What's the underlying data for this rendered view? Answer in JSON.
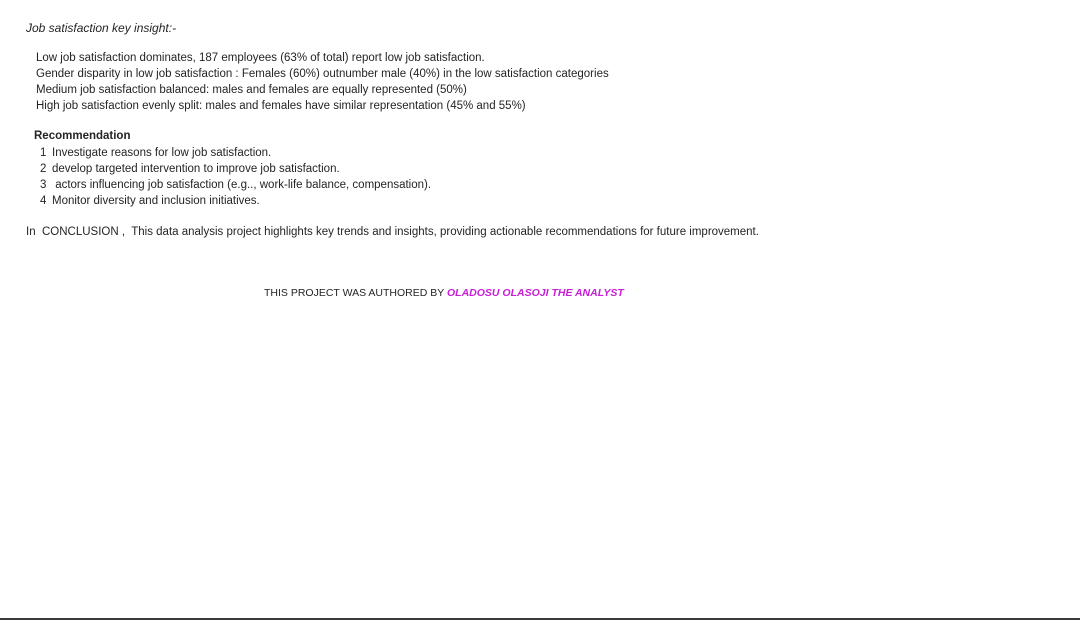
{
  "insights": {
    "heading": "Job satisfaction key insight:-",
    "items": [
      "Low job satisfaction dominates, 187 employees (63% of  total) report low job satisfaction.",
      "Gender disparity in low job satisfaction : Females (60%) outnumber male (40%) in the low satisfaction categories",
      "Medium job satisfaction balanced: males and females are equally represented (50%)",
      "High job satisfaction evenly split: males and females have similar representation (45% and 55%)"
    ]
  },
  "recommendation": {
    "heading": "Recommendation",
    "items": [
      {
        "number": "1",
        "text": "Investigate reasons for low job satisfaction."
      },
      {
        "number": "2",
        "text": "develop targeted intervention to improve job satisfaction."
      },
      {
        "number": "3",
        "text": " actors influencing job satisfaction (e.g.., work-life balance, compensation)."
      },
      {
        "number": "4",
        "text": "Monitor diversity and inclusion initiatives."
      }
    ]
  },
  "conclusion": {
    "text": "In  CONCLUSION ,  This data analysis project highlights key trends and insights, providing actionable recommendations for future improvement."
  },
  "author": {
    "prefix": "THIS PROJECT WAS AUTHORED BY ",
    "name": "OLADOSU OLASOJI THE ANALYST",
    "name_color": "#c71ed6"
  }
}
